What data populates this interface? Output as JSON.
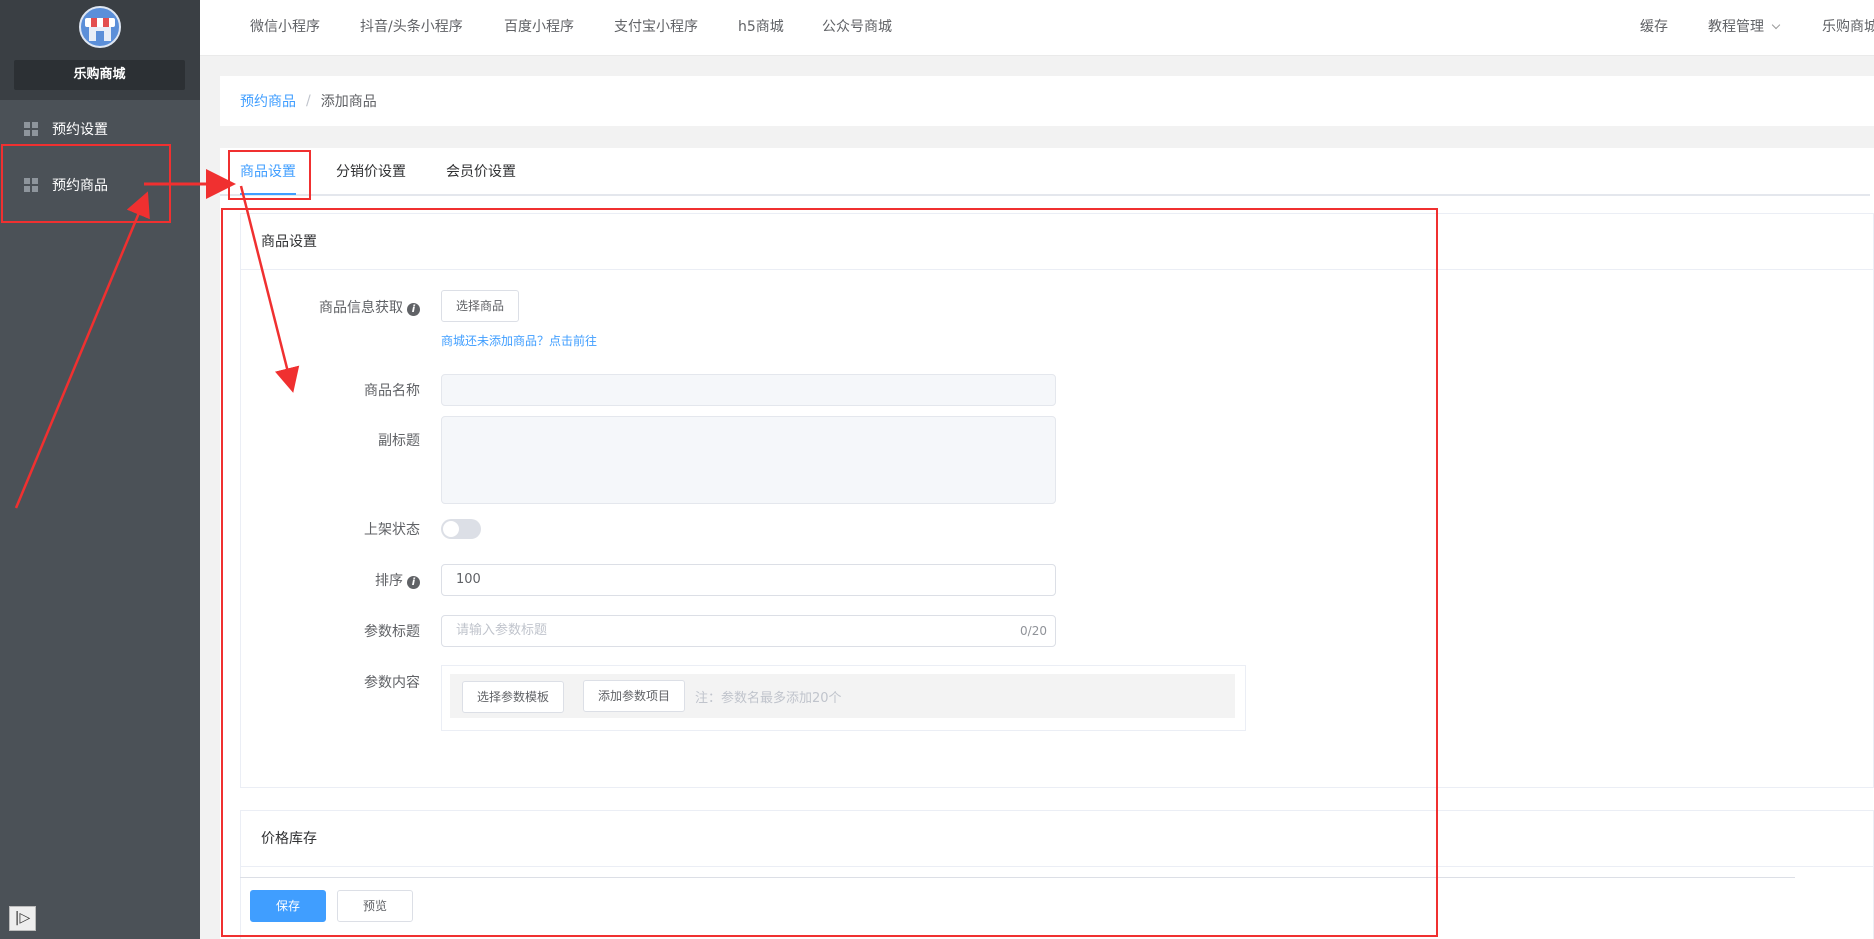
{
  "sidebar": {
    "store_name": "乐购商城",
    "items": [
      {
        "label": "预约设置",
        "icon": "grid-icon"
      },
      {
        "label": "预约商品",
        "icon": "grid-icon"
      }
    ],
    "collapse_icon": "collapse-icon"
  },
  "topbar": {
    "left_links": [
      "微信小程序",
      "抖音/头条小程序",
      "百度小程序",
      "支付宝小程序",
      "h5商城",
      "公众号商城"
    ],
    "cache_label": "缓存",
    "tutorial_label": "教程管理",
    "user_label": "乐购商城"
  },
  "breadcrumb": {
    "parent": "预约商品",
    "separator": "/",
    "current": "添加商品"
  },
  "tabs": [
    {
      "label": "商品设置",
      "active": true
    },
    {
      "label": "分销价设置",
      "active": false
    },
    {
      "label": "会员价设置",
      "active": false
    }
  ],
  "section_goods": {
    "title": "商品设置",
    "fetch_label": "商品信息获取",
    "select_goods_button": "选择商品",
    "no_goods_hint": "商城还未添加商品？点击前往",
    "name_label": "商品名称",
    "name_value": "",
    "subtitle_label": "副标题",
    "status_label": "上架状态",
    "status_on": false,
    "sort_label": "排序",
    "sort_value": "100",
    "param_title_label": "参数标题",
    "param_title_placeholder": "请输入参数标题",
    "param_title_counter": "0/20",
    "param_content_label": "参数内容",
    "select_template_button": "选择参数模板",
    "add_param_button": "添加参数项目",
    "param_note": "注：参数名最多添加20个"
  },
  "section_price": {
    "title": "价格库存"
  },
  "footer": {
    "save_label": "保存",
    "preview_label": "预览"
  },
  "colors": {
    "accent": "#409eff",
    "sidebar_bg": "#4b5157",
    "annotation_red": "#f03030"
  }
}
